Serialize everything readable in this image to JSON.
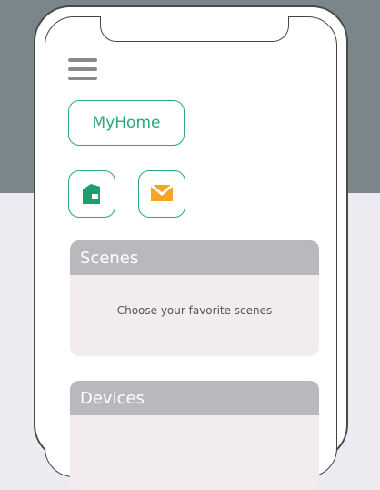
{
  "header": {
    "home_label": "MyHome"
  },
  "icons": {
    "home": {
      "name": "home-icon",
      "color": "#1e9e6a"
    },
    "mail": {
      "name": "mail-icon",
      "color": "#f5a524"
    },
    "menu": {
      "name": "menu-icon",
      "color": "#8a8a8a"
    }
  },
  "colors": {
    "accent": "#2aa876",
    "top_background": "#7b868b",
    "page_background": "#ecebf1",
    "card_header": "#b9b9bd",
    "card_body": "#f3ecef"
  },
  "cards": {
    "scenes": {
      "title": "Scenes",
      "body": "Choose your favorite scenes"
    },
    "devices": {
      "title": "Devices"
    }
  }
}
